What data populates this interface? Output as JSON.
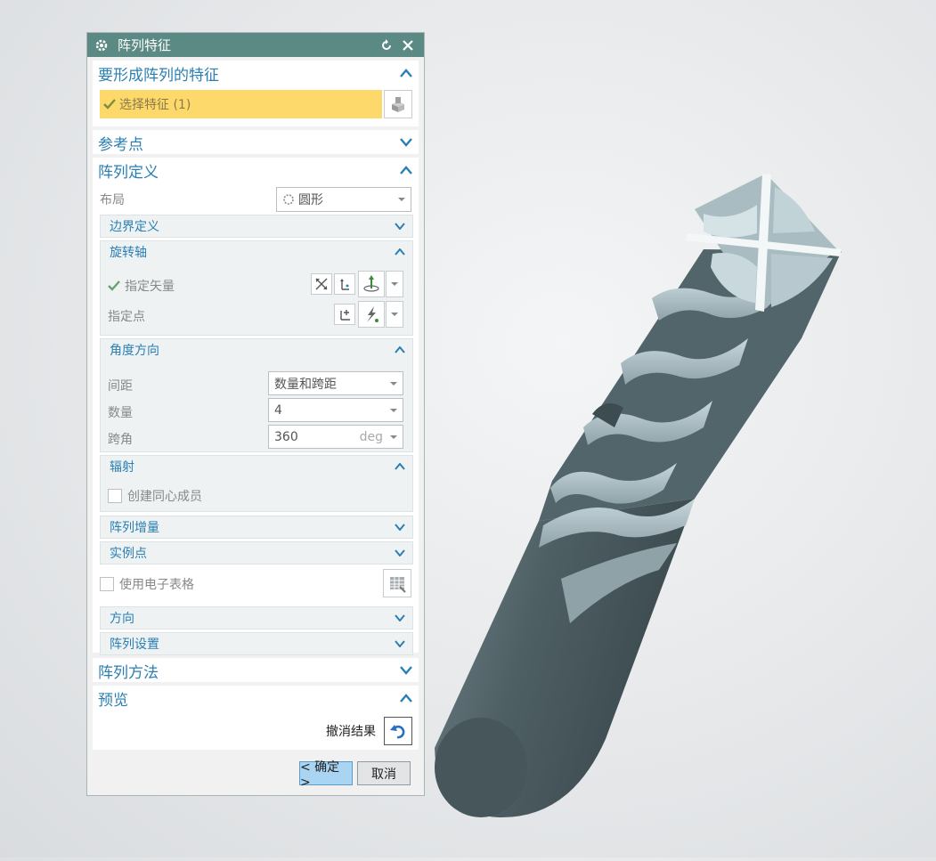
{
  "dialog": {
    "title": "阵列特征",
    "features_group": {
      "label": "要形成阵列的特征",
      "select_feature": "选择特征 (1)"
    },
    "reference_point_group": {
      "label": "参考点"
    },
    "pattern_definition_group": {
      "label": "阵列定义",
      "layout_label": "布局",
      "layout_value": "圆形",
      "boundary": "边界定义",
      "rotation_axis": {
        "label": "旋转轴",
        "specify_vector": "指定矢量",
        "specify_point": "指定点"
      },
      "angle_direction": {
        "label": "角度方向",
        "spacing_label": "间距",
        "spacing_value": "数量和跨距",
        "count_label": "数量",
        "count_value": "4",
        "span_label": "跨角",
        "span_value": "360",
        "span_unit": "deg"
      },
      "radiate": {
        "label": "辐射",
        "concentric": "创建同心成员"
      },
      "pattern_increment": "阵列增量",
      "instance_point": "实例点",
      "use_spreadsheet": "使用电子表格",
      "orientation": "方向",
      "pattern_settings": "阵列设置"
    },
    "pattern_method_group": {
      "label": "阵列方法"
    },
    "preview_group": {
      "label": "预览",
      "undo_result": "撤消结果"
    },
    "ok_label": "< 确定 >",
    "cancel_label": "取消"
  },
  "colors": {
    "titlebar": "#5b8a84",
    "accent": "#2b7fb3",
    "selection": "#fcd96a",
    "ok_button": "#a9d5f2"
  }
}
